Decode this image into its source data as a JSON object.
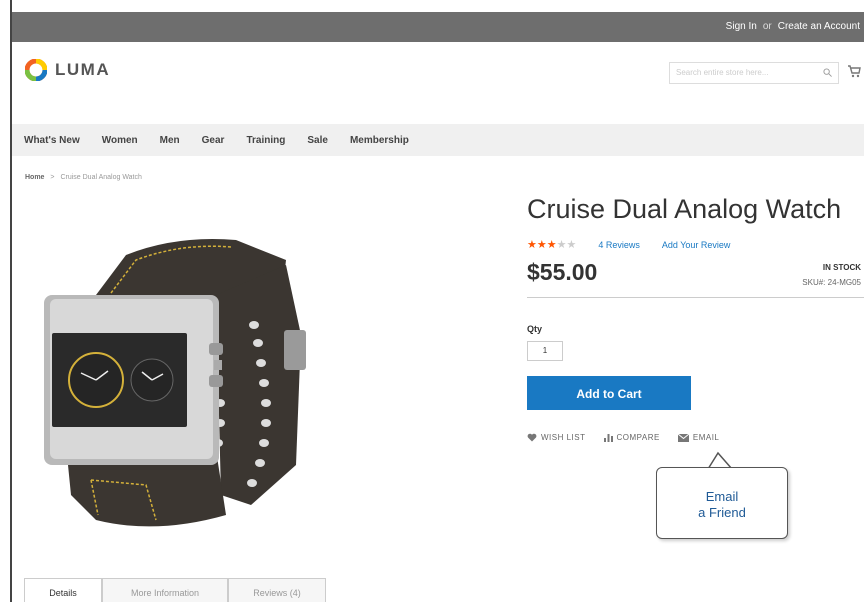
{
  "topbar": {
    "sign_in": "Sign In",
    "or": "or",
    "create_account": "Create an Account"
  },
  "header": {
    "logo_text": "LUMA",
    "search_placeholder": "Search entire store here..."
  },
  "nav": {
    "items": [
      "What's New",
      "Women",
      "Men",
      "Gear",
      "Training",
      "Sale",
      "Membership"
    ]
  },
  "breadcrumb": {
    "home": "Home",
    "separator": ">",
    "current": "Cruise Dual Analog Watch"
  },
  "product": {
    "title": "Cruise Dual Analog Watch",
    "rating_stars": 3,
    "rating_max": 5,
    "reviews_link": "4 Reviews",
    "add_review_link": "Add Your Review",
    "price": "$55.00",
    "stock": "IN STOCK",
    "sku_label": "SKU#:",
    "sku_value": "24-MG05",
    "qty_label": "Qty",
    "qty_value": "1",
    "add_to_cart": "Add to Cart",
    "wishlist": "WISH LIST",
    "compare": "COMPARE",
    "email": "EMAIL"
  },
  "callout": {
    "line1": "Email",
    "line2": "a Friend"
  },
  "tabs": [
    "Details",
    "More Information",
    "Reviews (4)"
  ],
  "colors": {
    "accent": "#1979c3",
    "star": "#ff5501",
    "topbar": "#6e6e6e",
    "nav_bg": "#f0f0f0"
  }
}
